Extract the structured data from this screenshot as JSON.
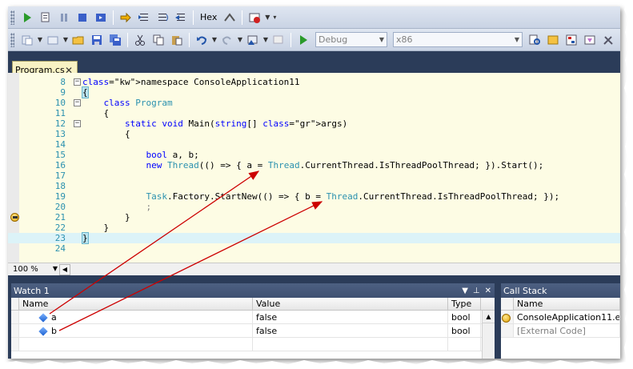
{
  "toolbar1": {
    "hex_label": "Hex"
  },
  "toolbar2": {
    "config_value": "Debug",
    "platform_value": "x86"
  },
  "document_tab": {
    "label": "Program.cs",
    "close_glyph": "✕"
  },
  "editor": {
    "lines": [
      {
        "num": "8",
        "code": "namespace ConsoleApplication11"
      },
      {
        "num": "9",
        "code": "{"
      },
      {
        "num": "10",
        "code": "    class Program"
      },
      {
        "num": "11",
        "code": "    {"
      },
      {
        "num": "12",
        "code": "        static void Main(string[] args)"
      },
      {
        "num": "13",
        "code": "        {"
      },
      {
        "num": "14",
        "code": ""
      },
      {
        "num": "15",
        "code": "            bool a, b;"
      },
      {
        "num": "16",
        "code": "            new Thread(() => { a = Thread.CurrentThread.IsThreadPoolThread; }).Start();"
      },
      {
        "num": "17",
        "code": ""
      },
      {
        "num": "18",
        "code": ""
      },
      {
        "num": "19",
        "code": "            Task.Factory.StartNew(() => { b = Thread.CurrentThread.IsThreadPoolThread; });"
      },
      {
        "num": "20",
        "code": "            ;"
      },
      {
        "num": "21",
        "code": "        }"
      },
      {
        "num": "22",
        "code": "    }"
      },
      {
        "num": "23",
        "code": "}"
      },
      {
        "num": "24",
        "code": ""
      }
    ],
    "zoom": "100 %"
  },
  "watch": {
    "title": "Watch 1",
    "columns": [
      "Name",
      "Value",
      "Type"
    ],
    "rows": [
      {
        "name": "a",
        "value": "false",
        "type": "bool"
      },
      {
        "name": "b",
        "value": "false",
        "type": "bool"
      }
    ]
  },
  "callstack": {
    "title": "Call Stack",
    "column": "Name",
    "rows": [
      {
        "name": "ConsoleApplication11.e"
      },
      {
        "name": "[External Code]"
      }
    ]
  },
  "colors": {
    "keyword": "#0000ff",
    "type": "#2b91af",
    "annotation_arrow": "#cc0000"
  }
}
